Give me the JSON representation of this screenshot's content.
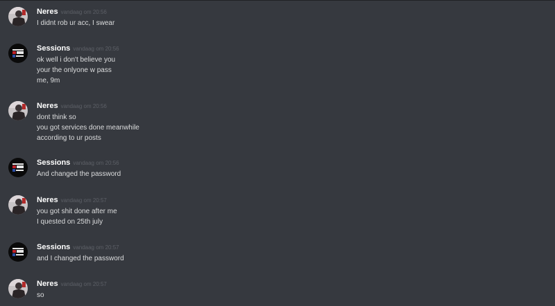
{
  "messages": [
    {
      "author": "Neres",
      "avatar": "neres-avatar",
      "timestamp": "vandaag om 20:56",
      "lines": [
        "I didnt rob ur acc, I swear"
      ]
    },
    {
      "author": "Sessions",
      "avatar": "sessions-avatar",
      "timestamp": "vandaag om 20:56",
      "lines": [
        "ok well i don't believe you",
        "your the onlyone w pass",
        "me, 9m"
      ]
    },
    {
      "author": "Neres",
      "avatar": "neres-avatar",
      "timestamp": "vandaag om 20:56",
      "lines": [
        "dont think so",
        "you got services done meanwhile",
        "according to ur posts"
      ]
    },
    {
      "author": "Sessions",
      "avatar": "sessions-avatar",
      "timestamp": "vandaag om 20:56",
      "lines": [
        "And changed the password"
      ]
    },
    {
      "author": "Neres",
      "avatar": "neres-avatar",
      "timestamp": "vandaag om 20:57",
      "lines": [
        "you got shit done after me",
        "I quested on 25th july"
      ]
    },
    {
      "author": "Sessions",
      "avatar": "sessions-avatar",
      "timestamp": "vandaag om 20:57",
      "lines": [
        "and I changed the password"
      ]
    },
    {
      "author": "Neres",
      "avatar": "neres-avatar",
      "timestamp": "vandaag om 20:57",
      "lines": [
        "so"
      ]
    }
  ]
}
